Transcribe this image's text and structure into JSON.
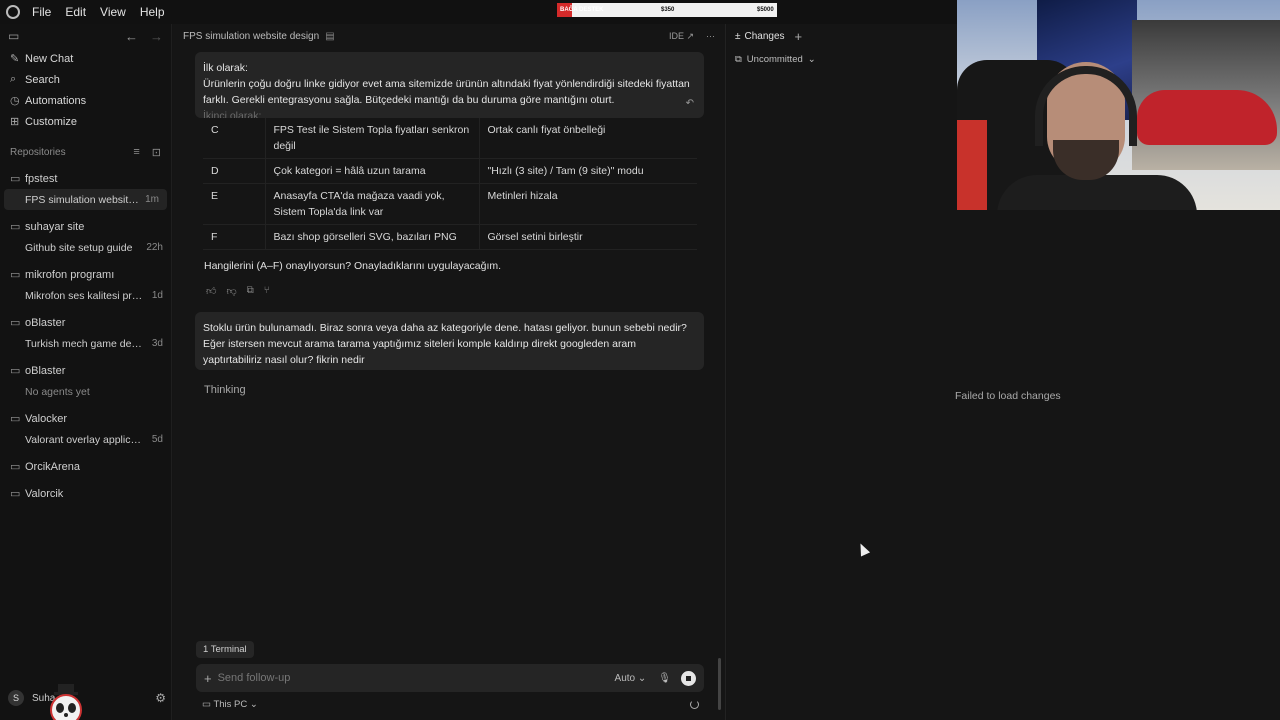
{
  "menubar": {
    "items": [
      "File",
      "Edit",
      "View",
      "Help"
    ]
  },
  "donation_bar": {
    "label": "BAĞA DESTEK",
    "current": "$350",
    "goal": "$5000",
    "progress": 0.07,
    "color": "#d42a2a"
  },
  "sidebar": {
    "nav": [
      {
        "label": "New Chat",
        "icon": "edit-icon"
      },
      {
        "label": "Search",
        "icon": "search-icon"
      },
      {
        "label": "Automations",
        "icon": "clock-icon"
      },
      {
        "label": "Customize",
        "icon": "puzzle-icon"
      }
    ],
    "repositories_label": "Repositories",
    "repos": [
      {
        "name": "fpstest",
        "chats": [
          {
            "label": "FPS simulation website design",
            "age": "1m",
            "active": true
          }
        ]
      },
      {
        "name": "suhayar site",
        "chats": [
          {
            "label": "Github site setup guide",
            "age": "22h"
          }
        ]
      },
      {
        "name": "mikrofon programı",
        "chats": [
          {
            "label": "Mikrofon ses kalitesi programı",
            "age": "1d"
          }
        ]
      },
      {
        "name": "oBlaster",
        "chats": [
          {
            "label": "Turkish mech game develop...",
            "age": "3d"
          }
        ]
      },
      {
        "name": "oBlaster",
        "chats": [
          {
            "label": "No agents yet",
            "age": "",
            "muted": true
          }
        ]
      },
      {
        "name": "Valocker",
        "chats": [
          {
            "label": "Valorant overlay application",
            "age": "5d"
          }
        ]
      },
      {
        "name": "OrcikArena",
        "chats": []
      },
      {
        "name": "Valorcik",
        "chats": []
      }
    ],
    "user": {
      "initial": "S",
      "name": "Suha"
    }
  },
  "chat": {
    "title": "FPS simulation website design",
    "ide_label": "IDE ↗",
    "first_message": {
      "line1": "İlk olarak:",
      "line2": "Ürünlerin çoğu doğru linke gidiyor evet ama sitemizde ürünün altındaki fiyat yönlendirdiği sitedeki fiyattan farklı. Gerekli entegrasyonu sağla.  Bütçedeki mantığı da bu duruma göre mantığını oturt.",
      "line3": "İkinci olarak:"
    },
    "table": [
      {
        "id": "C",
        "issue": "FPS Test ile Sistem Topla fiyatları senkron değil",
        "fix": "Ortak canlı fiyat önbelleği"
      },
      {
        "id": "D",
        "issue": "Çok kategori = hâlâ uzun tarama",
        "fix": "\"Hızlı (3 site) / Tam (9 site)\" modu"
      },
      {
        "id": "E",
        "issue": "Anasayfa CTA'da mağaza vaadi yok, Sistem Topla'da link var",
        "fix": "Metinleri hizala"
      },
      {
        "id": "F",
        "issue": "Bazı shop görselleri SVG, bazıları PNG",
        "fix": "Görsel setini birleştir"
      }
    ],
    "question": "Hangilerini (A–F) onaylıyorsun? Onayladıklarını uygulayacağım.",
    "second_message": "Stoklu ürün bulunamadı. Biraz sonra veya daha az kategoriyle dene. hatası geliyor. bunun sebebi nedir? Eğer istersen mevcut arama tarama yaptığımız siteleri komple kaldırıp direkt googleden aram yaptırtabiliriz nasıl olur? fikrin nedir",
    "thinking": "Thinking",
    "terminal_chip": "1 Terminal",
    "composer": {
      "placeholder": "Send follow-up",
      "mode": "Auto"
    },
    "footer_location": "This PC"
  },
  "changes": {
    "tab": "Changes",
    "filter": "Uncommitted",
    "error": "Failed to load changes"
  }
}
